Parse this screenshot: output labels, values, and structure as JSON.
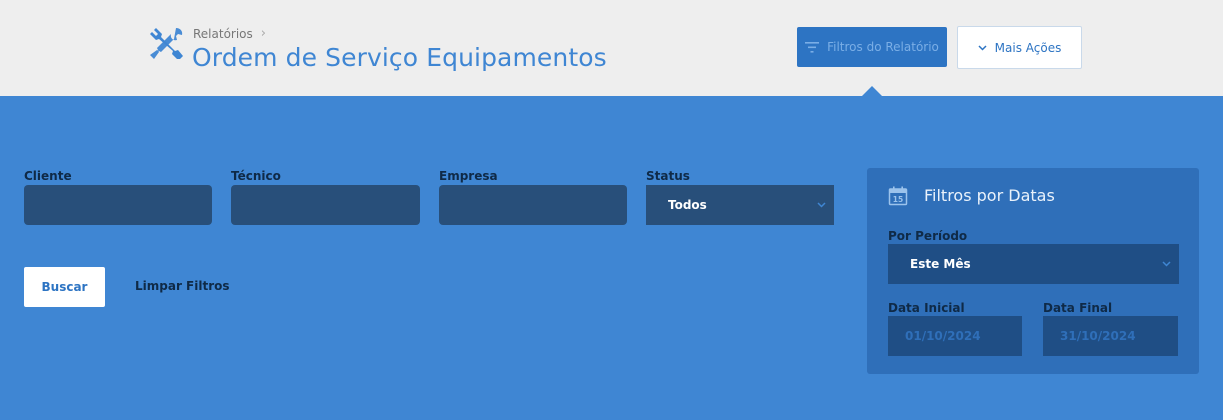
{
  "header": {
    "breadcrumb": "Relatórios",
    "title": "Ordem de Serviço Equipamentos",
    "title_icon": "tools-icon",
    "filters_button": "Filtros do Relatório",
    "actions_button": "Mais Ações"
  },
  "filters": {
    "cliente_label": "Cliente",
    "cliente_value": "",
    "tecnico_label": "Técnico",
    "tecnico_value": "",
    "empresa_label": "Empresa",
    "empresa_value": "",
    "status_label": "Status",
    "status_value": "Todos",
    "search_button": "Buscar",
    "clear_link": "Limpar Filtros"
  },
  "date_filters": {
    "title": "Filtros por Datas",
    "periodo_label": "Por Período",
    "periodo_value": "Este Mês",
    "data_inicial_label": "Data Inicial",
    "data_inicial_value": "01/10/2024",
    "data_final_label": "Data Final",
    "data_final_value": "31/10/2024"
  },
  "colors": {
    "accent": "#3f86d3",
    "panel": "#3f86d3",
    "input_bg": "#284f7a",
    "card_bg": "#2f6fb9"
  }
}
